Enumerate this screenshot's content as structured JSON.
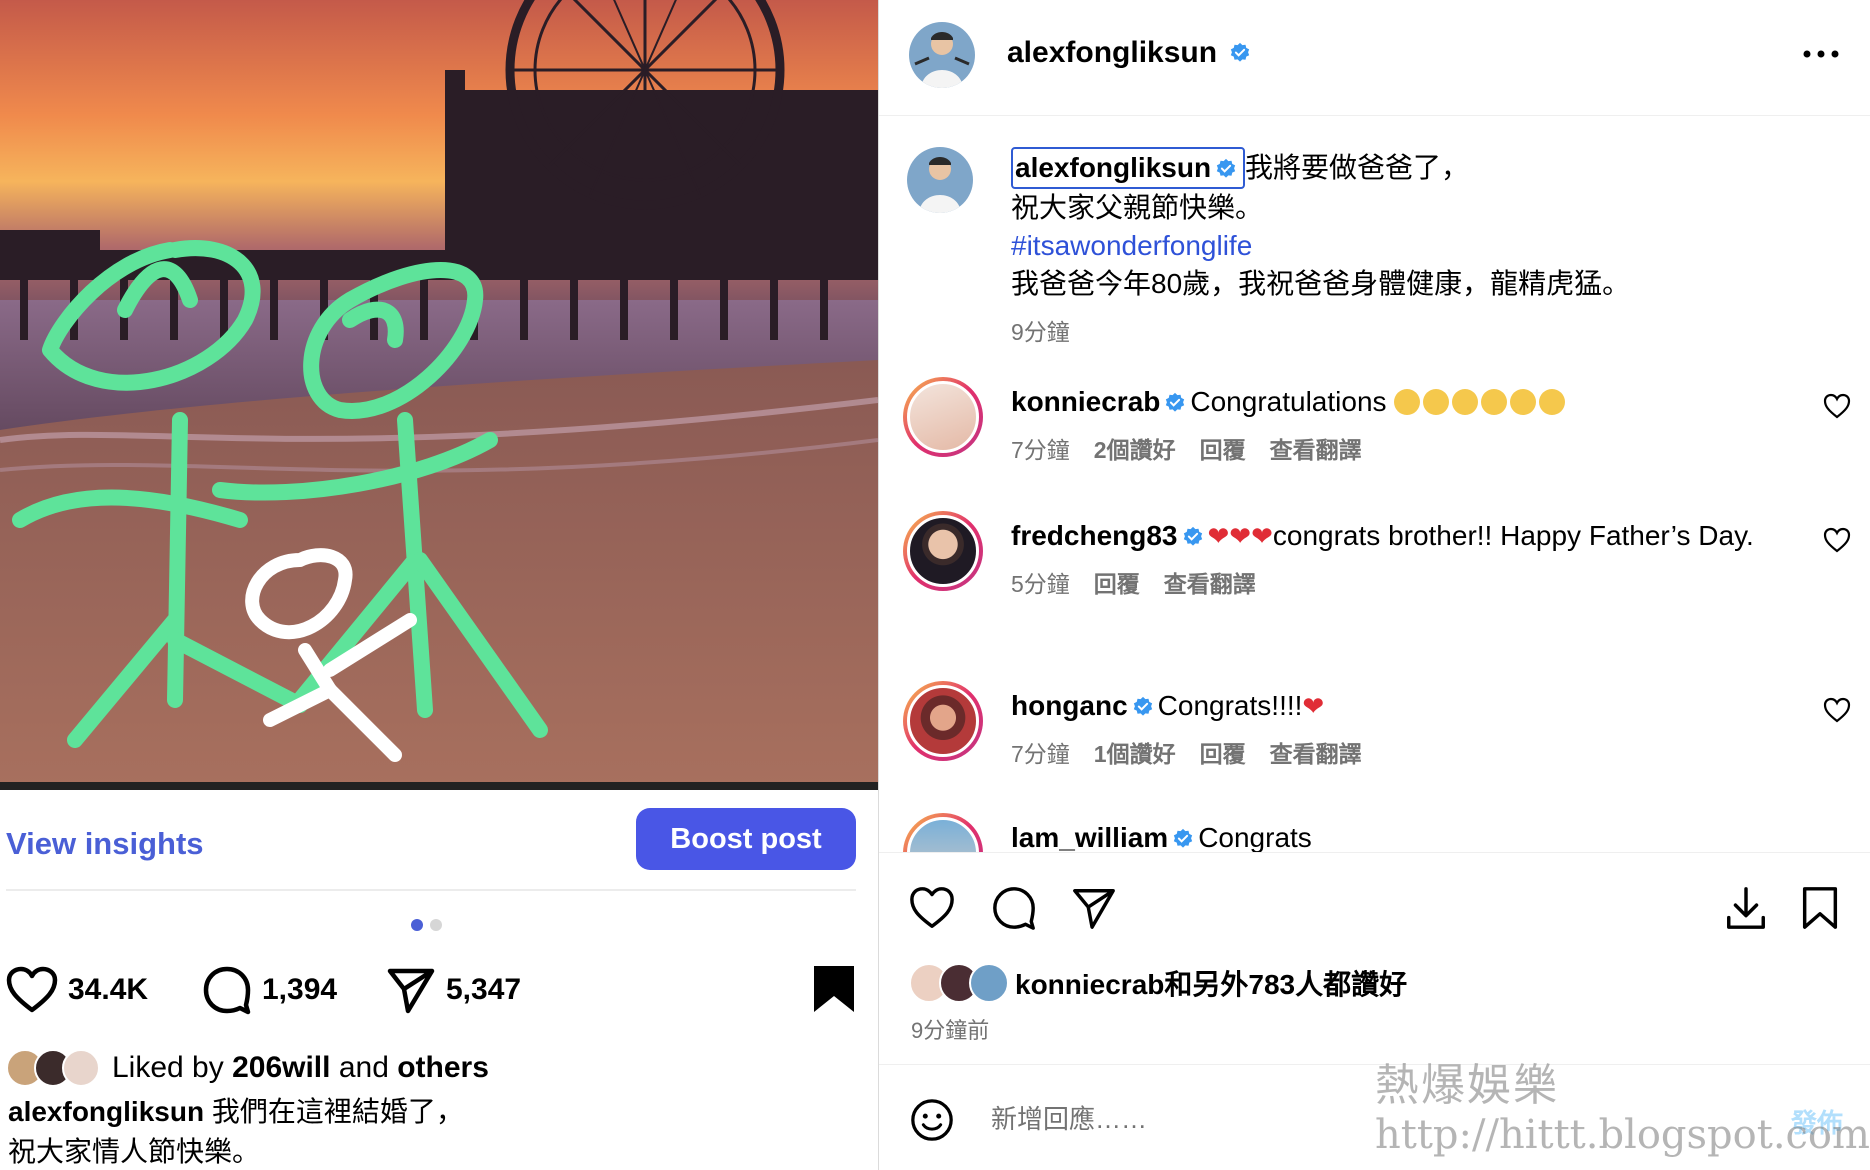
{
  "left_post": {
    "view_insights": "View insights",
    "boost_post": "Boost post",
    "likes_count": "34.4K",
    "comments_count": "1,394",
    "shares_count": "5,347",
    "liked_by_prefix": "Liked by ",
    "liked_by_user": "206will",
    "liked_by_suffix": " and ",
    "liked_by_others": "others",
    "caption_user": "alexfongliksun",
    "caption_line1": " 我們在這裡結婚了，",
    "caption_line2": "祝大家情人節快樂。"
  },
  "right_post": {
    "header": {
      "username": "alexfongliksun"
    },
    "caption": {
      "username": "alexfongliksun",
      "line1": "我將要做爸爸了，",
      "line2": "祝大家父親節快樂。",
      "hashtag": "#itsawonderfonglife",
      "line3": "我爸爸今年80歲，我祝爸爸身體健康，龍精虎猛。",
      "time": "9分鐘"
    },
    "comments": [
      {
        "username": "konniecrab",
        "text": "Congratulations",
        "time": "7分鐘",
        "likes": "2個讚好",
        "reply": "回覆",
        "translate": "查看翻譯"
      },
      {
        "username": "fredcheng83",
        "text": "congrats brother!! Happy Father’s Day.",
        "time": "5分鐘",
        "reply": "回覆",
        "translate": "查看翻譯"
      },
      {
        "username": "honganc",
        "text": "Congrats!!!!",
        "time": "7分鐘",
        "likes": "1個讚好",
        "reply": "回覆",
        "translate": "查看翻譯"
      },
      {
        "username": "lam_william",
        "text": "Congrats"
      }
    ],
    "likes_summary": "konniecrab和另外783人都讚好",
    "post_time": "9分鐘前",
    "comment_placeholder": "新增回應……",
    "post_button": "發佈"
  },
  "watermark": {
    "title": "熱爆娛樂",
    "url": "http://hittt.blogspot.com"
  },
  "colors": {
    "accent_blue": "#4956e6",
    "link_blue": "#2e51d8",
    "verified_blue": "#3897f0",
    "drawing_green": "#5ee39a",
    "heart_red": "#e02d36"
  }
}
